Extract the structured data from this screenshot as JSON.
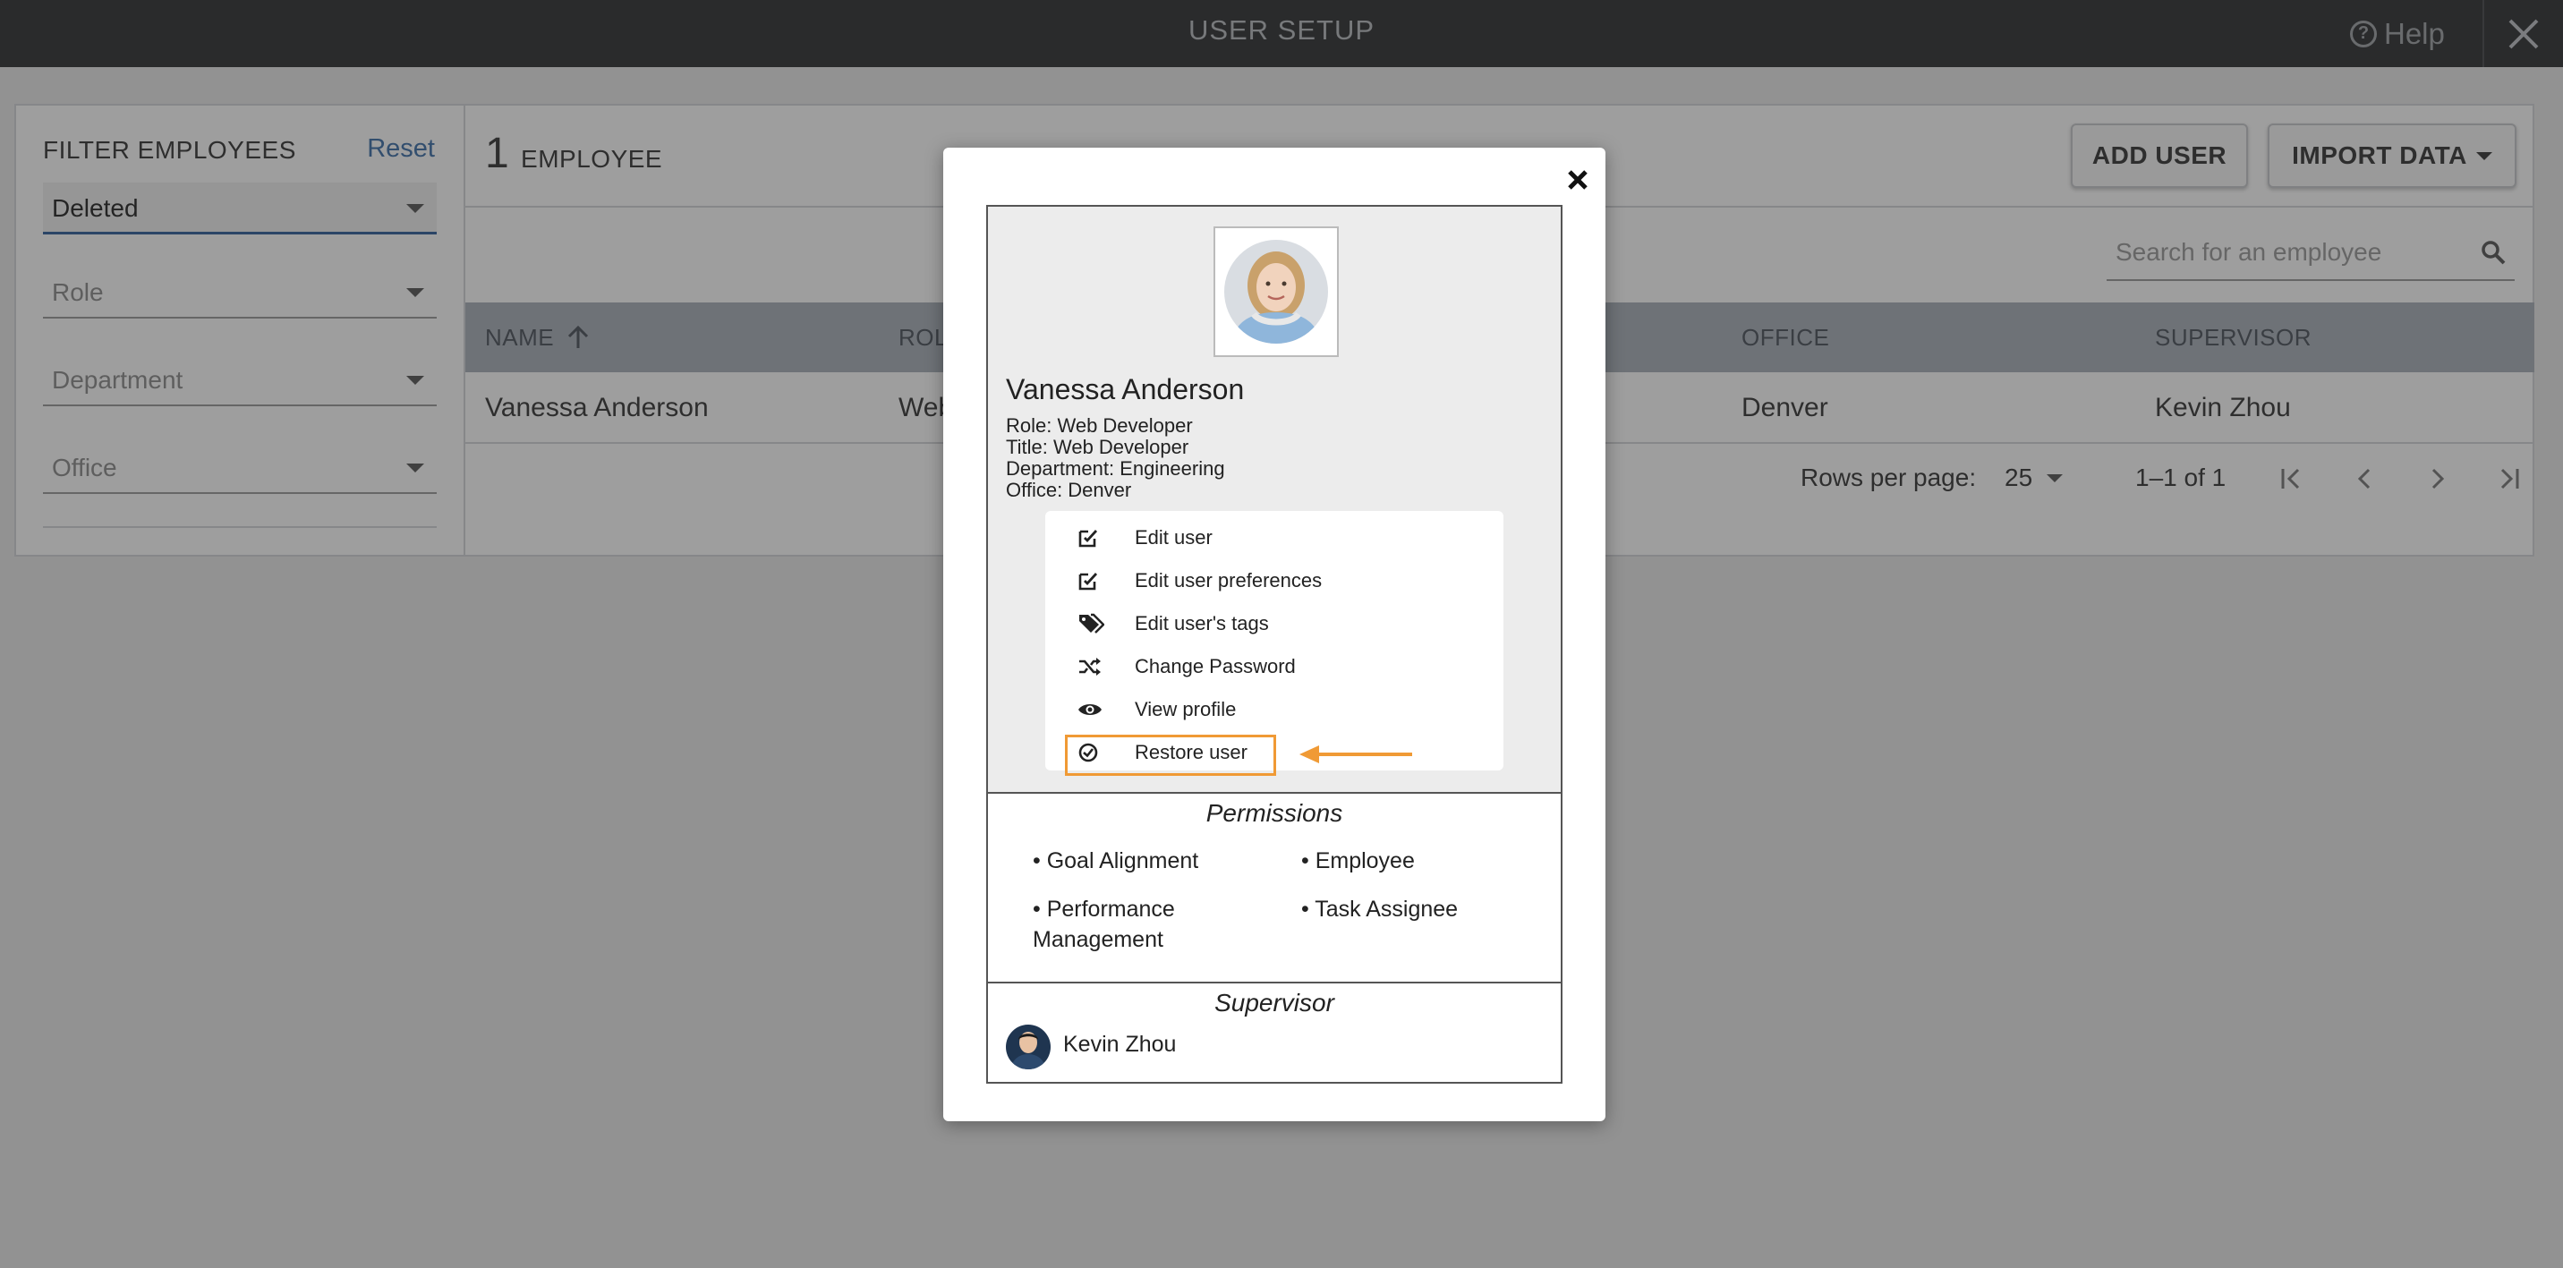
{
  "topbar": {
    "title": "USER SETUP",
    "help_label": "Help"
  },
  "filter": {
    "heading": "FILTER EMPLOYEES",
    "reset_label": "Reset",
    "status_value": "Deleted",
    "role_placeholder": "Role",
    "department_placeholder": "Department",
    "office_placeholder": "Office"
  },
  "list": {
    "count": "1",
    "count_label": "EMPLOYEE",
    "add_user_label": "ADD USER",
    "import_label": "IMPORT DATA",
    "search_placeholder": "Search for an employee",
    "columns": {
      "name": "NAME",
      "role": "ROLE",
      "office": "OFFICE",
      "supervisor": "SUPERVISOR"
    },
    "rows": [
      {
        "name": "Vanessa Anderson",
        "role": "Web Developer",
        "office": "Denver",
        "supervisor": "Kevin Zhou"
      }
    ],
    "rows_per_page_label": "Rows per page:",
    "rows_per_page_value": "25",
    "range": "1–1 of 1"
  },
  "modal": {
    "user": {
      "name": "Vanessa Anderson",
      "role": "Role: Web Developer",
      "title": "Title: Web Developer",
      "department": "Department: Engineering",
      "office": "Office: Denver"
    },
    "menu": [
      {
        "label": "Edit user",
        "icon": "edit-icon"
      },
      {
        "label": "Edit user preferences",
        "icon": "edit-icon"
      },
      {
        "label": "Edit user's tags",
        "icon": "tags-icon"
      },
      {
        "label": "Change Password",
        "icon": "shuffle-icon"
      },
      {
        "label": "View profile",
        "icon": "eye-icon"
      },
      {
        "label": "Restore user",
        "icon": "check-circle-icon"
      }
    ],
    "permissions_title": "Permissions",
    "permissions": [
      "• Goal Alignment",
      "• Employee",
      "• Performance Management",
      "• Task Assignee"
    ],
    "supervisor_title": "Supervisor",
    "supervisor_name": "Kevin Zhou",
    "highlight_color": "#f09a35"
  }
}
